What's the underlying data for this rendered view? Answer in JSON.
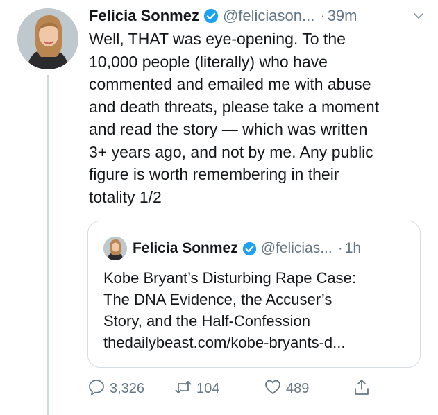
{
  "tweet": {
    "author": {
      "name": "Felicia Sonmez",
      "handle": "@feliciason...",
      "avatar_icon": "user-avatar"
    },
    "separator": "·",
    "time": "39m",
    "text": "Well, THAT was eye-opening. To the\n10,000 people (literally) who have\ncommented and emailed me with abuse\nand death threats, please take a moment\nand read the story — which was written\n3+ years ago, and not by me. Any public\nfigure is worth remembering in their\ntotality 1/2"
  },
  "quoted": {
    "author": {
      "name": "Felicia Sonmez",
      "handle": "@felicias...",
      "avatar_icon": "user-avatar"
    },
    "separator": "·",
    "time": "1h",
    "text": "Kobe Bryant’s Disturbing Rape Case:\nThe DNA Evidence, the Accuser’s\nStory, and the Half-Confession\nthedailybeast.com/kobe-bryants-d..."
  },
  "actions": {
    "replies": "3,326",
    "retweets": "104",
    "likes": "489"
  },
  "colors": {
    "verified": "#1da1f2",
    "secondary_text": "#657786",
    "border": "#d6dde2"
  }
}
